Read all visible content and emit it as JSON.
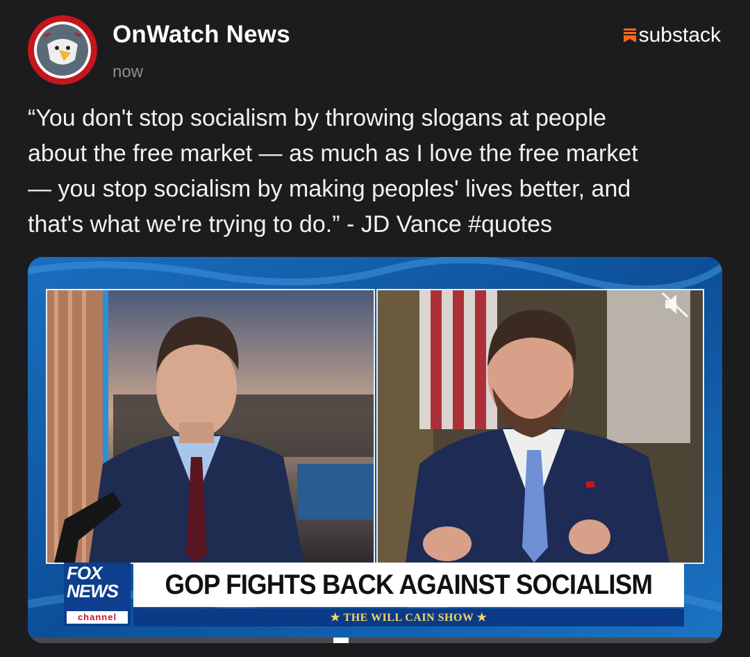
{
  "post": {
    "author": "OnWatch News",
    "time": "now",
    "source": "substack",
    "text_lines": [
      "“You don't stop socialism by throwing slogans at people",
      "about the free market — as much as I love the free market",
      "— you stop socialism by making peoples' lives better, and",
      "that's what we're trying to do.” - JD Vance #quotes"
    ]
  },
  "video": {
    "network_logo": "FOX NEWS channel",
    "logo_line1": "FOX",
    "logo_line2": "NEWS",
    "logo_line3": "channel",
    "headline": "GOP FIGHTS BACK AGAINST SOCIALISM",
    "show": "★ THE WILL CAIN SHOW ★",
    "muted": true,
    "progress": 0.44
  },
  "icons": {
    "avatar": "eagle-avatar",
    "source": "substack-icon",
    "mute": "muted-speaker-icon"
  },
  "colors": {
    "background": "#1c1c1e",
    "secondary_text": "#8e8e93",
    "substack_orange": "#ff6719",
    "fox_blue": "#0d3f8e"
  }
}
